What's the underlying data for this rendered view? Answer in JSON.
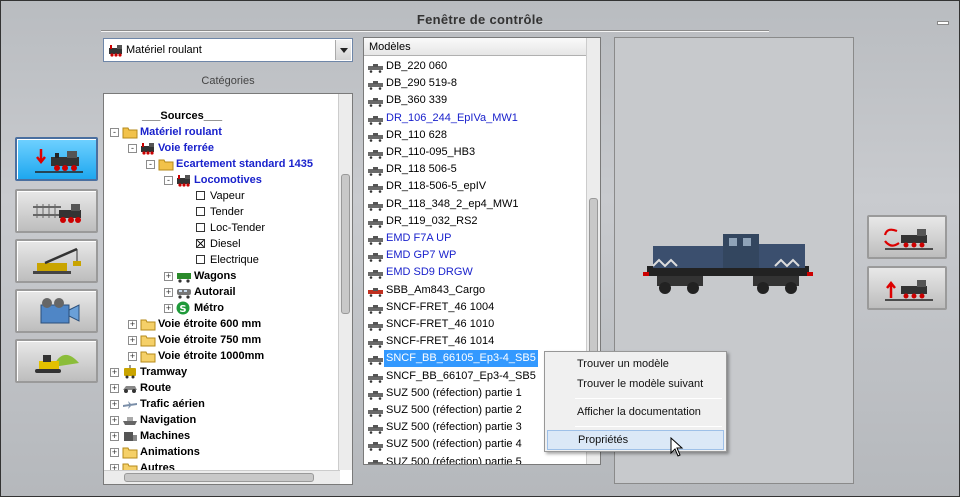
{
  "window": {
    "title": "Fenêtre de contrôle"
  },
  "category_select": {
    "value": "Matériel roulant"
  },
  "categories_label": "Catégories",
  "tree": [
    {
      "label": "___Sources___",
      "level": 0,
      "bold": true,
      "blue": false,
      "expander": "",
      "icon": "none"
    },
    {
      "label": "Matériel roulant",
      "level": 0,
      "bold": true,
      "blue": true,
      "expander": "-",
      "icon": "folder-open"
    },
    {
      "label": "Voie ferrée",
      "level": 1,
      "bold": true,
      "blue": true,
      "expander": "-",
      "icon": "loco"
    },
    {
      "label": "Ecartement standard 1435",
      "level": 2,
      "bold": true,
      "blue": true,
      "expander": "-",
      "icon": "folder-open"
    },
    {
      "label": "Locomotives",
      "level": 3,
      "bold": true,
      "blue": true,
      "expander": "-",
      "icon": "loco"
    },
    {
      "label": "Vapeur",
      "level": 4,
      "bold": false,
      "blue": false,
      "expander": "",
      "icon": "check"
    },
    {
      "label": "Tender",
      "level": 4,
      "bold": false,
      "blue": false,
      "expander": "",
      "icon": "check"
    },
    {
      "label": "Loc-Tender",
      "level": 4,
      "bold": false,
      "blue": false,
      "expander": "",
      "icon": "check"
    },
    {
      "label": "Diesel",
      "level": 4,
      "bold": false,
      "blue": false,
      "expander": "",
      "icon": "check-x"
    },
    {
      "label": "Electrique",
      "level": 4,
      "bold": false,
      "blue": false,
      "expander": "",
      "icon": "check"
    },
    {
      "label": "Wagons",
      "level": 3,
      "bold": true,
      "blue": false,
      "expander": "+",
      "icon": "wagon"
    },
    {
      "label": "Autorail",
      "level": 3,
      "bold": true,
      "blue": false,
      "expander": "+",
      "icon": "railcar"
    },
    {
      "label": "Métro",
      "level": 3,
      "bold": true,
      "blue": false,
      "expander": "+",
      "icon": "metro"
    },
    {
      "label": "Voie étroite 600 mm",
      "level": 1,
      "bold": true,
      "blue": false,
      "expander": "+",
      "icon": "folder"
    },
    {
      "label": "Voie étroite 750 mm",
      "level": 1,
      "bold": true,
      "blue": false,
      "expander": "+",
      "icon": "folder"
    },
    {
      "label": "Voie étroite 1000mm",
      "level": 1,
      "bold": true,
      "blue": false,
      "expander": "+",
      "icon": "folder"
    },
    {
      "label": "Tramway",
      "level": 0,
      "bold": true,
      "blue": false,
      "expander": "+",
      "icon": "tram"
    },
    {
      "label": "Route",
      "level": 0,
      "bold": true,
      "blue": false,
      "expander": "+",
      "icon": "car"
    },
    {
      "label": "Trafic aérien",
      "level": 0,
      "bold": true,
      "blue": false,
      "expander": "+",
      "icon": "plane"
    },
    {
      "label": "Navigation",
      "level": 0,
      "bold": true,
      "blue": false,
      "expander": "+",
      "icon": "ship"
    },
    {
      "label": "Machines",
      "level": 0,
      "bold": true,
      "blue": false,
      "expander": "+",
      "icon": "machine"
    },
    {
      "label": "Animations",
      "level": 0,
      "bold": true,
      "blue": false,
      "expander": "+",
      "icon": "folder"
    },
    {
      "label": "Autres",
      "level": 0,
      "bold": true,
      "blue": false,
      "expander": "+",
      "icon": "folder"
    }
  ],
  "models_header": "Modèles",
  "models": [
    {
      "label": "DB_220 060",
      "blue": false,
      "selected": false,
      "icon": "diesel-gray"
    },
    {
      "label": "DB_290 519-8",
      "blue": false,
      "selected": false,
      "icon": "diesel-gray"
    },
    {
      "label": "DB_360 339",
      "blue": false,
      "selected": false,
      "icon": "diesel-gray"
    },
    {
      "label": "DR_106_244_EpIVa_MW1",
      "blue": true,
      "selected": false,
      "icon": "diesel-gray"
    },
    {
      "label": "DR_110 628",
      "blue": false,
      "selected": false,
      "icon": "diesel-gray"
    },
    {
      "label": "DR_110-095_HB3",
      "blue": false,
      "selected": false,
      "icon": "diesel-gray"
    },
    {
      "label": "DR_118 506-5",
      "blue": false,
      "selected": false,
      "icon": "diesel-gray"
    },
    {
      "label": "DR_118-506-5_epIV",
      "blue": false,
      "selected": false,
      "icon": "diesel-gray"
    },
    {
      "label": "DR_118_348_2_ep4_MW1",
      "blue": false,
      "selected": false,
      "icon": "diesel-gray"
    },
    {
      "label": "DR_119_032_RS2",
      "blue": false,
      "selected": false,
      "icon": "diesel-gray"
    },
    {
      "label": "EMD F7A UP",
      "blue": true,
      "selected": false,
      "icon": "diesel-gray"
    },
    {
      "label": "EMD GP7 WP",
      "blue": true,
      "selected": false,
      "icon": "diesel-gray"
    },
    {
      "label": "EMD SD9 DRGW",
      "blue": true,
      "selected": false,
      "icon": "diesel-gray"
    },
    {
      "label": "SBB_Am843_Cargo",
      "blue": false,
      "selected": false,
      "icon": "diesel-red"
    },
    {
      "label": "SNCF-FRET_46 1004",
      "blue": false,
      "selected": false,
      "icon": "diesel-gray"
    },
    {
      "label": "SNCF-FRET_46 1010",
      "blue": false,
      "selected": false,
      "icon": "diesel-gray"
    },
    {
      "label": "SNCF-FRET_46 1014",
      "blue": false,
      "selected": false,
      "icon": "diesel-gray"
    },
    {
      "label": "SNCF_BB_66105_Ep3-4_SB5",
      "blue": false,
      "selected": true,
      "icon": "diesel-gray"
    },
    {
      "label": "SNCF_BB_66107_Ep3-4_SB5",
      "blue": false,
      "selected": false,
      "icon": "diesel-gray"
    },
    {
      "label": "SUZ 500 (réfection) partie 1",
      "blue": false,
      "selected": false,
      "icon": "diesel-gray"
    },
    {
      "label": "SUZ 500 (réfection) partie 2",
      "blue": false,
      "selected": false,
      "icon": "diesel-gray"
    },
    {
      "label": "SUZ 500 (réfection) partie 3",
      "blue": false,
      "selected": false,
      "icon": "diesel-gray"
    },
    {
      "label": "SUZ 500 (réfection) partie 4",
      "blue": false,
      "selected": false,
      "icon": "diesel-gray"
    },
    {
      "label": "SUZ 500 (réfection) partie 5",
      "blue": false,
      "selected": false,
      "icon": "diesel-gray"
    }
  ],
  "context_menu": {
    "items": [
      {
        "label": "Trouver un modèle"
      },
      {
        "label": "Trouver le modèle suivant"
      },
      {
        "label": "Afficher la documentation"
      },
      {
        "label": "Propriétés"
      }
    ]
  },
  "left_tools": [
    {
      "name": "insert-rolling-stock-tool",
      "icon": "loco-down-arrow-icon",
      "active": true
    },
    {
      "name": "track-tool",
      "icon": "track-loco-icon",
      "active": false
    },
    {
      "name": "crane-tool",
      "icon": "crane-icon",
      "active": false
    },
    {
      "name": "camera-tool",
      "icon": "camera-icon",
      "active": false
    },
    {
      "name": "terrain-tool",
      "icon": "bulldozer-icon",
      "active": false
    }
  ],
  "right_tools": [
    {
      "name": "rotate-loco-tool",
      "icon": "loco-rotate-icon"
    },
    {
      "name": "lift-loco-tool",
      "icon": "loco-up-arrow-icon"
    }
  ],
  "colors": {
    "link_blue": "#1a22cc",
    "selection": "#3399ff",
    "active_tool": "#1ea7ef"
  }
}
